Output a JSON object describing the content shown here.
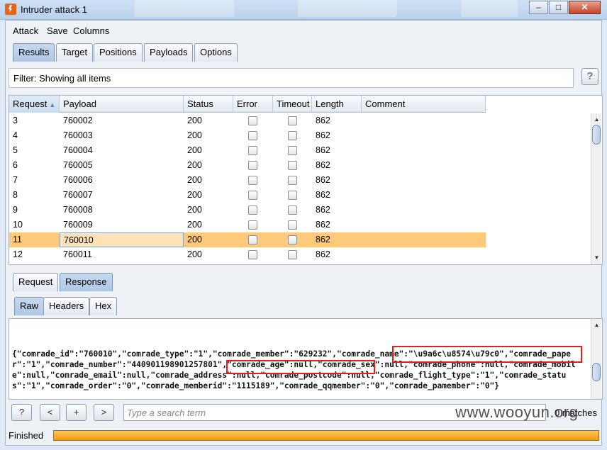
{
  "window": {
    "title": "Intruder attack 1",
    "minimize": "–",
    "maximize": "□",
    "close": "✕"
  },
  "menu": [
    "Attack",
    "Save",
    "Columns"
  ],
  "main_tabs": [
    {
      "label": "Results",
      "active": true
    },
    {
      "label": "Target",
      "active": false
    },
    {
      "label": "Positions",
      "active": false
    },
    {
      "label": "Payloads",
      "active": false
    },
    {
      "label": "Options",
      "active": false
    }
  ],
  "filter": {
    "text": "Filter: Showing all items",
    "help": "?"
  },
  "table": {
    "columns": [
      "Request",
      "Payload",
      "Status",
      "Error",
      "Timeout",
      "Length",
      "Comment"
    ],
    "sort_indicator": "▲",
    "rows": [
      {
        "request": "3",
        "payload": "760002",
        "status": "200",
        "error": false,
        "timeout": false,
        "length": "862",
        "comment": ""
      },
      {
        "request": "4",
        "payload": "760003",
        "status": "200",
        "error": false,
        "timeout": false,
        "length": "862",
        "comment": ""
      },
      {
        "request": "5",
        "payload": "760004",
        "status": "200",
        "error": false,
        "timeout": false,
        "length": "862",
        "comment": ""
      },
      {
        "request": "6",
        "payload": "760005",
        "status": "200",
        "error": false,
        "timeout": false,
        "length": "862",
        "comment": ""
      },
      {
        "request": "7",
        "payload": "760006",
        "status": "200",
        "error": false,
        "timeout": false,
        "length": "862",
        "comment": ""
      },
      {
        "request": "8",
        "payload": "760007",
        "status": "200",
        "error": false,
        "timeout": false,
        "length": "862",
        "comment": ""
      },
      {
        "request": "9",
        "payload": "760008",
        "status": "200",
        "error": false,
        "timeout": false,
        "length": "862",
        "comment": ""
      },
      {
        "request": "10",
        "payload": "760009",
        "status": "200",
        "error": false,
        "timeout": false,
        "length": "862",
        "comment": ""
      },
      {
        "request": "11",
        "payload": "760010",
        "status": "200",
        "error": false,
        "timeout": false,
        "length": "862",
        "comment": "",
        "selected": true
      },
      {
        "request": "12",
        "payload": "760011",
        "status": "200",
        "error": false,
        "timeout": false,
        "length": "862",
        "comment": ""
      }
    ]
  },
  "detail_tabs": [
    {
      "label": "Request",
      "active": false
    },
    {
      "label": "Response",
      "active": true
    }
  ],
  "view_tabs": [
    {
      "label": "Raw",
      "active": true
    },
    {
      "label": "Headers",
      "active": false
    },
    {
      "label": "Hex",
      "active": false
    }
  ],
  "response_body": "{\"comrade_id\":\"760010\",\"comrade_type\":\"1\",\"comrade_member\":\"629232\",\"comrade_name\":\"\\u9a6c\\u8574\\u79c0\",\"comrade_paper\":\"1\",\"comrade_number\":\"440901198901257801\",\"comrade_age\":null,\"comrade_sex\":null,\"comrade_phone\":null,\"comrade_mobile\":null,\"comrade_email\":null,\"comrade_address\":null,\"comrade_postcode\":null,\"comrade_flight_type\":\"1\",\"comrade_status\":\"1\",\"comrade_order\":\"0\",\"comrade_memberid\":\"1115189\",\"comrade_qqmember\":\"0\",\"comrade_pamember\":\"0\"}",
  "search": {
    "help": "?",
    "prev": "<",
    "add": "+",
    "next": ">",
    "placeholder": "Type a search term",
    "matches": "0 matches"
  },
  "status": {
    "text": "Finished",
    "progress": 1.0
  },
  "watermark": "www.wooyun.org",
  "colors": {
    "selected_row": "#fdc97a",
    "highlight_box": "#e0201c",
    "progress": "#f29a10"
  }
}
